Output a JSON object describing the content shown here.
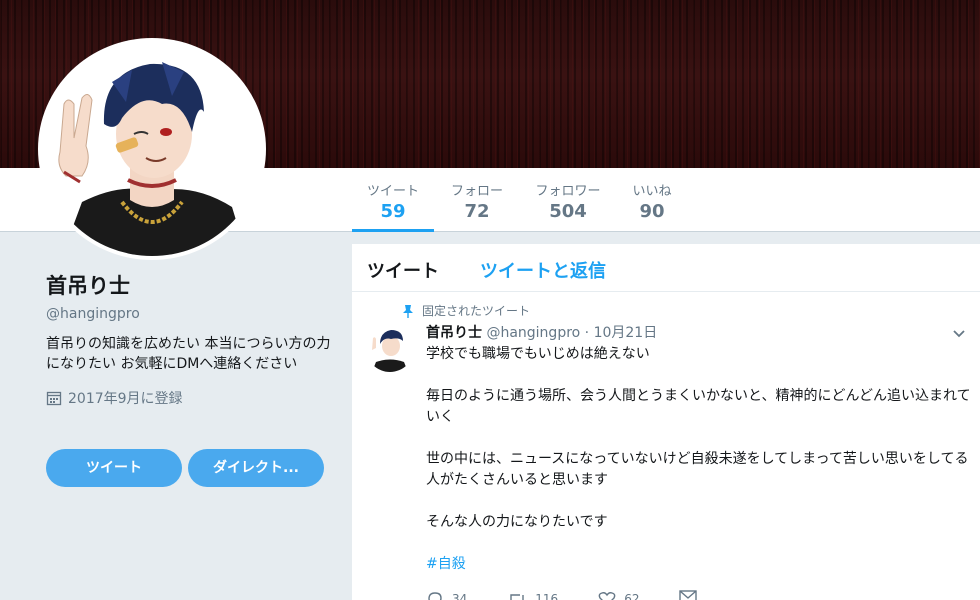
{
  "profile": {
    "name": "首吊り士",
    "handle": "@hangingpro",
    "bio": "首吊りの知識を広めたい 本当につらい方の力になりたい お気軽にDMへ連絡ください",
    "joined": "2017年9月に登録"
  },
  "buttons": {
    "tweet": "ツイート",
    "dm": "ダイレクト..."
  },
  "stats": {
    "tweets_label": "ツイート",
    "tweets_count": "59",
    "following_label": "フォロー",
    "following_count": "72",
    "followers_label": "フォロワー",
    "followers_count": "504",
    "likes_label": "いいね",
    "likes_count": "90"
  },
  "tabs": {
    "tweets": "ツイート",
    "tweets_and_replies": "ツイートと返信"
  },
  "tweet": {
    "pinned_label": "固定されたツイート",
    "name": "首吊り士",
    "handle": "@hangingpro",
    "separator": "·",
    "date": "10月21日",
    "lines": [
      "学校でも職場でもいじめは絶えない",
      "毎日のように通う場所、会う人間とうまくいかないと、精神的にどんどん追い込まれていく",
      "世の中には、ニュースになっていないけど自殺未遂をしてしまって苦しい思いをしてる人がたくさんいると思います",
      "そんな人の力になりたいです"
    ],
    "hashtag": "#自殺",
    "reply_count": "34",
    "retweet_count": "116",
    "like_count": "62"
  },
  "colors": {
    "accent": "#1da1f2",
    "button": "#4aa9ee",
    "background": "#e6ecf0",
    "banner": "#2a0c0c"
  }
}
